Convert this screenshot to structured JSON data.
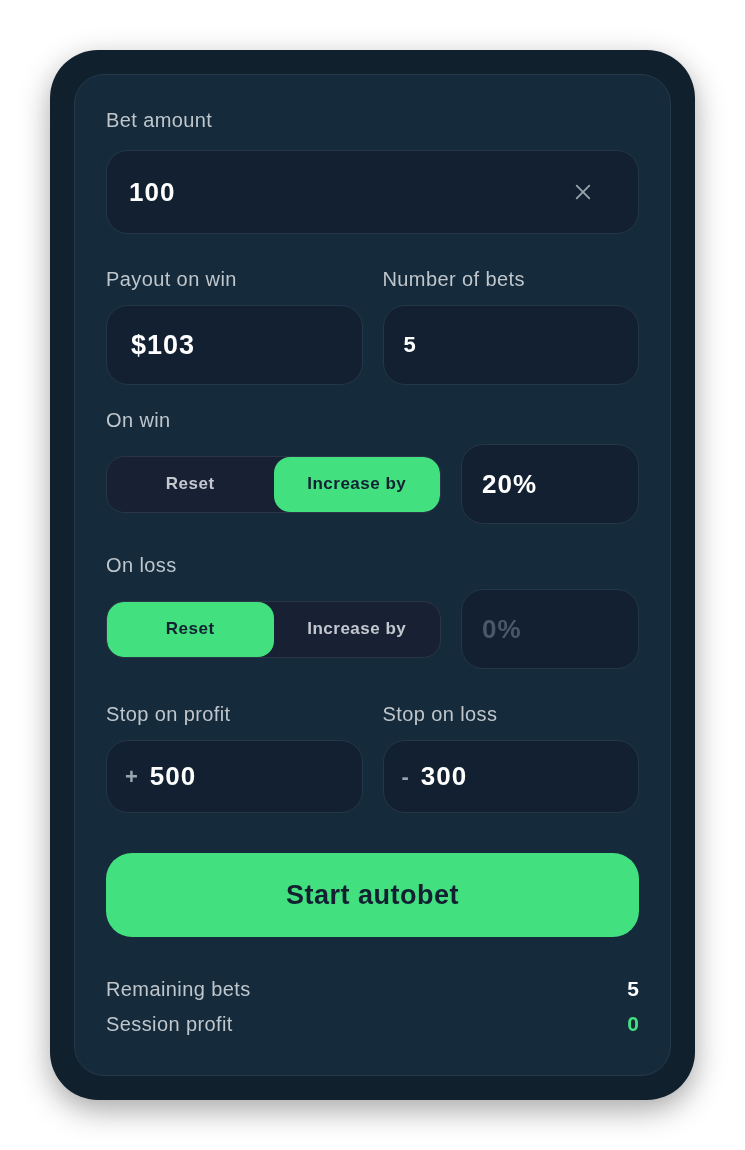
{
  "bet_amount": {
    "label": "Bet amount",
    "value": "100"
  },
  "payout": {
    "label": "Payout on win",
    "value": "$103"
  },
  "number_of_bets": {
    "label": "Number of bets",
    "value": "5"
  },
  "on_win": {
    "label": "On win",
    "options": [
      {
        "label": "Reset",
        "selected": false
      },
      {
        "label": "Increase by",
        "selected": true
      }
    ],
    "field": {
      "value": "20%"
    }
  },
  "on_loss": {
    "label": "On loss",
    "options": [
      {
        "label": "Reset",
        "selected": true
      },
      {
        "label": "Increase by",
        "selected": false
      }
    ],
    "field": {
      "placeholder": "0%"
    }
  },
  "stop_on_profit": {
    "label": "Stop on profit",
    "prefix": "+",
    "value": "500"
  },
  "stop_on_loss": {
    "label": "Stop on loss",
    "prefix": "-",
    "value": "300"
  },
  "button": "Start autobet",
  "stats": [
    {
      "label": "Remaining bets",
      "value": "5",
      "color": "#ffffff"
    },
    {
      "label": "Session profit",
      "value": "0",
      "color": "#42e07f"
    }
  ]
}
